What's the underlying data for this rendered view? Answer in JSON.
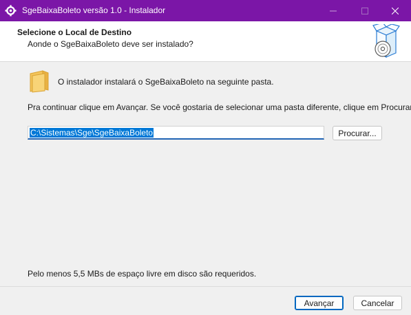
{
  "window": {
    "title": "SgeBaixaBoleto versão 1.0 - Instalador",
    "accent_color": "#7b16a7"
  },
  "header": {
    "title": "Selecione o Local de Destino",
    "subtitle": "Aonde o SgeBaixaBoleto deve ser instalado?",
    "icon": "setup-box-disc-icon"
  },
  "body": {
    "folder_icon": "folder-icon",
    "intro": "O instalador instalará o SgeBaixaBoleto na seguinte pasta.",
    "instructions": "Pra continuar clique em Avançar. Se você gostaria de selecionar uma pasta diferente, clique em Procurar.",
    "path_value": "C:\\Sistemas\\Sge\\SgeBaixaBoleto",
    "browse_label": "Procurar...",
    "space_required": "Pelo menos 5,5 MBs de espaço livre em disco são requeridos."
  },
  "footer": {
    "next_label": "Avançar",
    "cancel_label": "Cancelar"
  }
}
